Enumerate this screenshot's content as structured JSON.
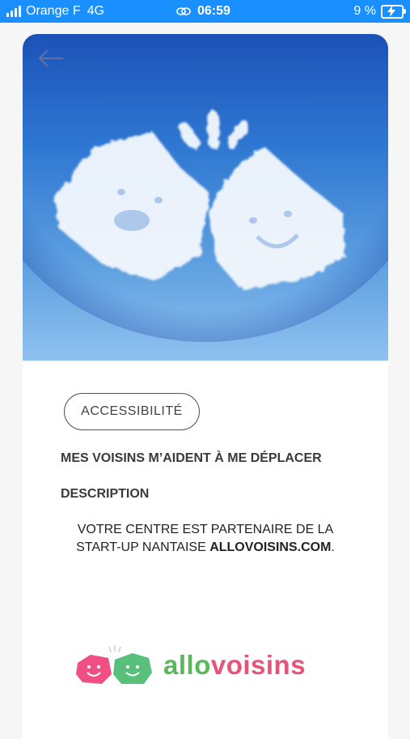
{
  "status_bar": {
    "carrier": "Orange F",
    "network": "4G",
    "time": "06:59",
    "battery": "9 %",
    "background_color": "#1a8fff"
  },
  "hero": {
    "back_icon": "arrow-left-icon",
    "image_description": "sky-with-cloud-houses"
  },
  "content": {
    "category_tag": "ACCESSIBILITÉ",
    "headline": "MES VOISINS M’AIDENT À ME DÉPLACER",
    "description_label": "DESCRIPTION",
    "description_line1": "VOTRE CENTRE EST PARTENAIRE DE LA",
    "description_line2_prefix": "START-UP NANTAISE ",
    "description_line2_bold": "ALLOVOISINS.COM",
    "description_line2_suffix": "."
  },
  "logo": {
    "part1": "allo",
    "part2": "voisins",
    "color_green": "#59b85a",
    "color_pink": "#e8537a"
  }
}
